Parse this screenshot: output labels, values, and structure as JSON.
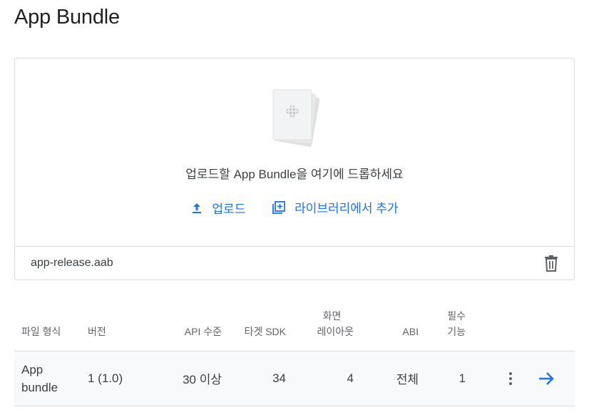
{
  "page_title": "App Bundle",
  "upload": {
    "drop_message": "업로드할 App Bundle을 여기에 드롭하세요",
    "upload_label": "업로드",
    "library_label": "라이브러리에서 추가"
  },
  "file": {
    "name": "app-release.aab"
  },
  "table": {
    "headers": {
      "type": "파일 형식",
      "version": "버전",
      "api": "API 수준",
      "target_sdk": "타겟 SDK",
      "layout_line1": "화면",
      "layout_line2": "레이아웃",
      "abi": "ABI",
      "features_line1": "필수",
      "features_line2": "기능"
    },
    "rows": [
      {
        "type_line1": "App",
        "type_line2": "bundle",
        "version": "1 (1.0)",
        "api": "30 이상",
        "target_sdk": "34",
        "layouts": "4",
        "abi": "전체",
        "features": "1"
      }
    ]
  },
  "colors": {
    "accent": "#1a73e8",
    "border": "#dadce0",
    "row_bg": "#f8f9fa"
  },
  "icons": [
    "upload-icon",
    "library-add-icon",
    "trash-icon",
    "more-vert-icon",
    "arrow-right-icon",
    "app-bundle-icon"
  ]
}
